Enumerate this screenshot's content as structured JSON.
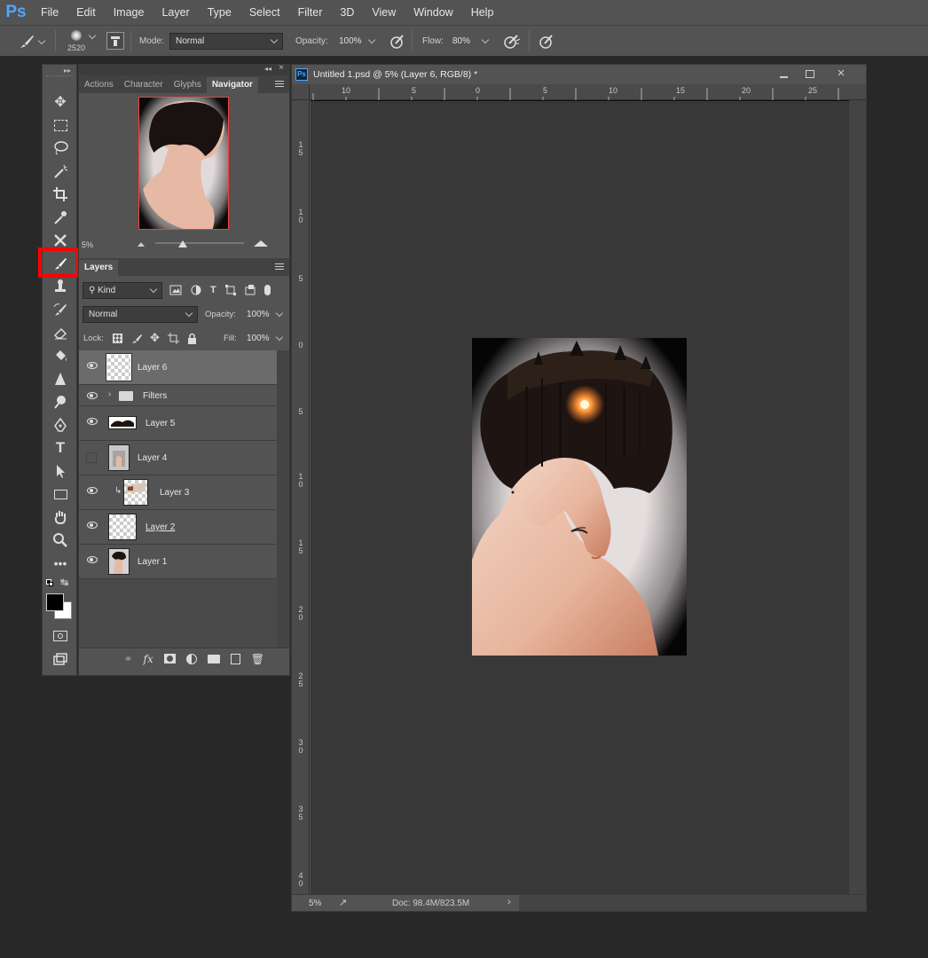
{
  "app": {
    "logo": "Ps"
  },
  "menu": [
    "File",
    "Edit",
    "Image",
    "Layer",
    "Type",
    "Select",
    "Filter",
    "3D",
    "View",
    "Window",
    "Help"
  ],
  "options": {
    "brush_size": "2520",
    "mode_label": "Mode:",
    "mode_value": "Normal",
    "opacity_label": "Opacity:",
    "opacity_value": "100%",
    "flow_label": "Flow:",
    "flow_value": "80%"
  },
  "top_panel": {
    "tabs": [
      "Actions",
      "Character",
      "Glyphs",
      "Navigator"
    ],
    "active_tab": "Navigator",
    "zoom": "5%"
  },
  "layers_panel": {
    "tab": "Layers",
    "filter_kind": "Kind",
    "blend_mode": "Normal",
    "opacity_label": "Opacity:",
    "opacity_value": "100%",
    "lock_label": "Lock:",
    "fill_label": "Fill:",
    "fill_value": "100%",
    "layers": [
      {
        "name": "Layer 6",
        "visible": true,
        "selected": true
      },
      {
        "name": "Filters",
        "visible": true,
        "group": true
      },
      {
        "name": "Layer 5",
        "visible": true
      },
      {
        "name": "Layer 4",
        "visible": false
      },
      {
        "name": "Layer 3",
        "visible": true,
        "clipped": true
      },
      {
        "name": "Layer 2",
        "visible": true
      },
      {
        "name": "Layer 1",
        "visible": true
      }
    ]
  },
  "document": {
    "title": "Untitled 1.psd @ 5% (Layer 6, RGB/8) *",
    "zoom": "5%",
    "doc_size": "Doc: 98.4M/823.5M",
    "ruler_top": [
      "10",
      "5",
      "0",
      "5",
      "10",
      "15",
      "20",
      "25"
    ],
    "ruler_left": [
      "1\n5",
      "1\n0",
      "5",
      "0",
      "5",
      "1\n0",
      "1\n5",
      "2\n0",
      "2\n5",
      "3\n0",
      "3\n5",
      "4\n0"
    ]
  },
  "colors": {
    "highlight": "#ff0000",
    "ps_blue": "#4ca8ff"
  }
}
